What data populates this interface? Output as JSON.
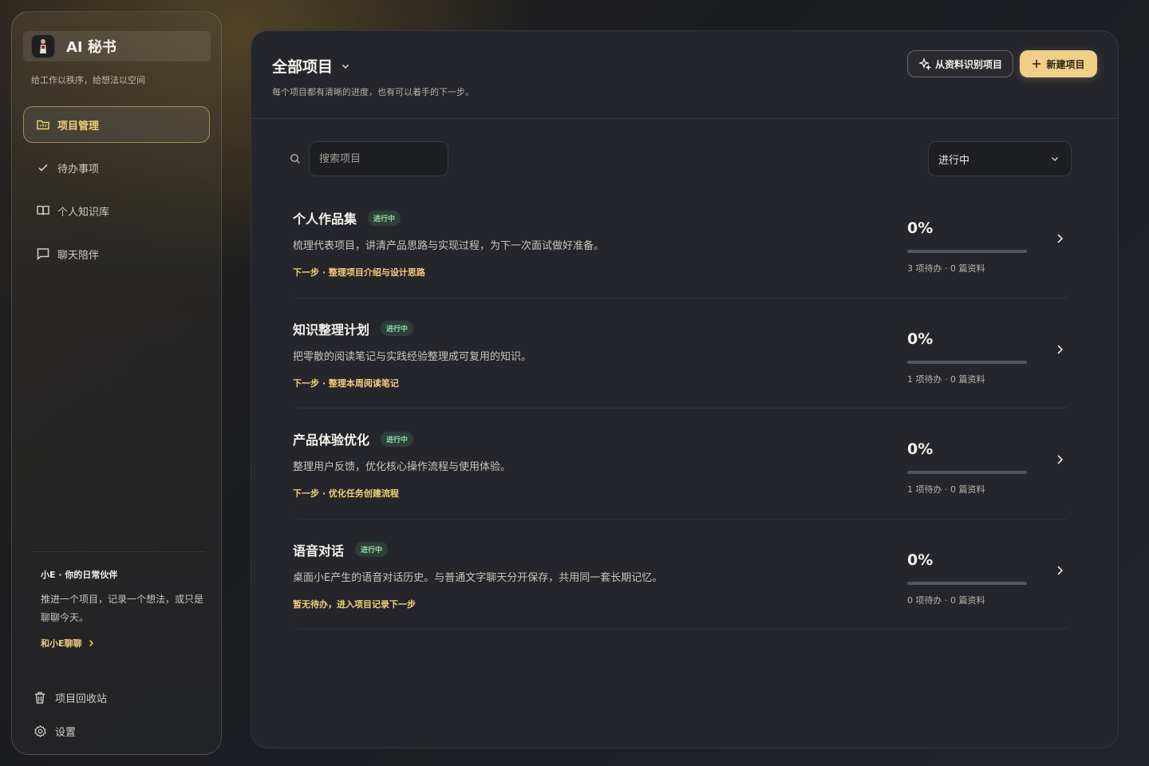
{
  "sidebar": {
    "brand": "AI 秘书",
    "tagline": "给工作以秩序，给想法以空间",
    "nav": [
      {
        "label": "项目管理",
        "icon": "folder-icon",
        "active": true
      },
      {
        "label": "待办事项",
        "icon": "check-icon",
        "active": false
      },
      {
        "label": "个人知识库",
        "icon": "book-icon",
        "active": false
      },
      {
        "label": "聊天陪伴",
        "icon": "chat-bubble-icon",
        "active": false
      }
    ],
    "card": {
      "title": "小E · 你的日常伙伴",
      "text": "推进一个项目，记录一个想法，或只是聊聊今天。",
      "link": "和小E聊聊"
    },
    "bottom": [
      {
        "label": "项目回收站",
        "icon": "trash-icon"
      },
      {
        "label": "设置",
        "icon": "gear-icon"
      }
    ]
  },
  "header": {
    "title": "全部项目",
    "subtitle": "每个项目都有清晰的进度，也有可以着手的下一步。",
    "btn_identify": "从资料识别项目",
    "btn_new": "新建项目"
  },
  "filters": {
    "search_placeholder": "搜索项目",
    "status_selected": "进行中"
  },
  "accent": "#f0cf86",
  "projects": [
    {
      "title": "个人作品集",
      "badge": "进行中",
      "desc": "梳理代表项目，讲清产品思路与实现过程，为下一次面试做好准备。",
      "next": "下一步 · 整理项目介绍与设计思路",
      "progress": "0%",
      "progress_value": 0,
      "meta": "3 项待办 · 0 篇资料"
    },
    {
      "title": "知识整理计划",
      "badge": "进行中",
      "desc": "把零散的阅读笔记与实践经验整理成可复用的知识。",
      "next": "下一步 · 整理本周阅读笔记",
      "progress": "0%",
      "progress_value": 0,
      "meta": "1 项待办 · 0 篇资料"
    },
    {
      "title": "产品体验优化",
      "badge": "进行中",
      "desc": "整理用户反馈，优化核心操作流程与使用体验。",
      "next": "下一步 · 优化任务创建流程",
      "progress": "0%",
      "progress_value": 0,
      "meta": "1 项待办 · 0 篇资料"
    },
    {
      "title": "语音对话",
      "badge": "进行中",
      "desc": "桌面小E产生的语音对话历史。与普通文字聊天分开保存，共用同一套长期记忆。",
      "next": "暂无待办，进入项目记录下一步",
      "progress": "0%",
      "progress_value": 0,
      "meta": "0 项待办 · 0 篇资料"
    }
  ]
}
